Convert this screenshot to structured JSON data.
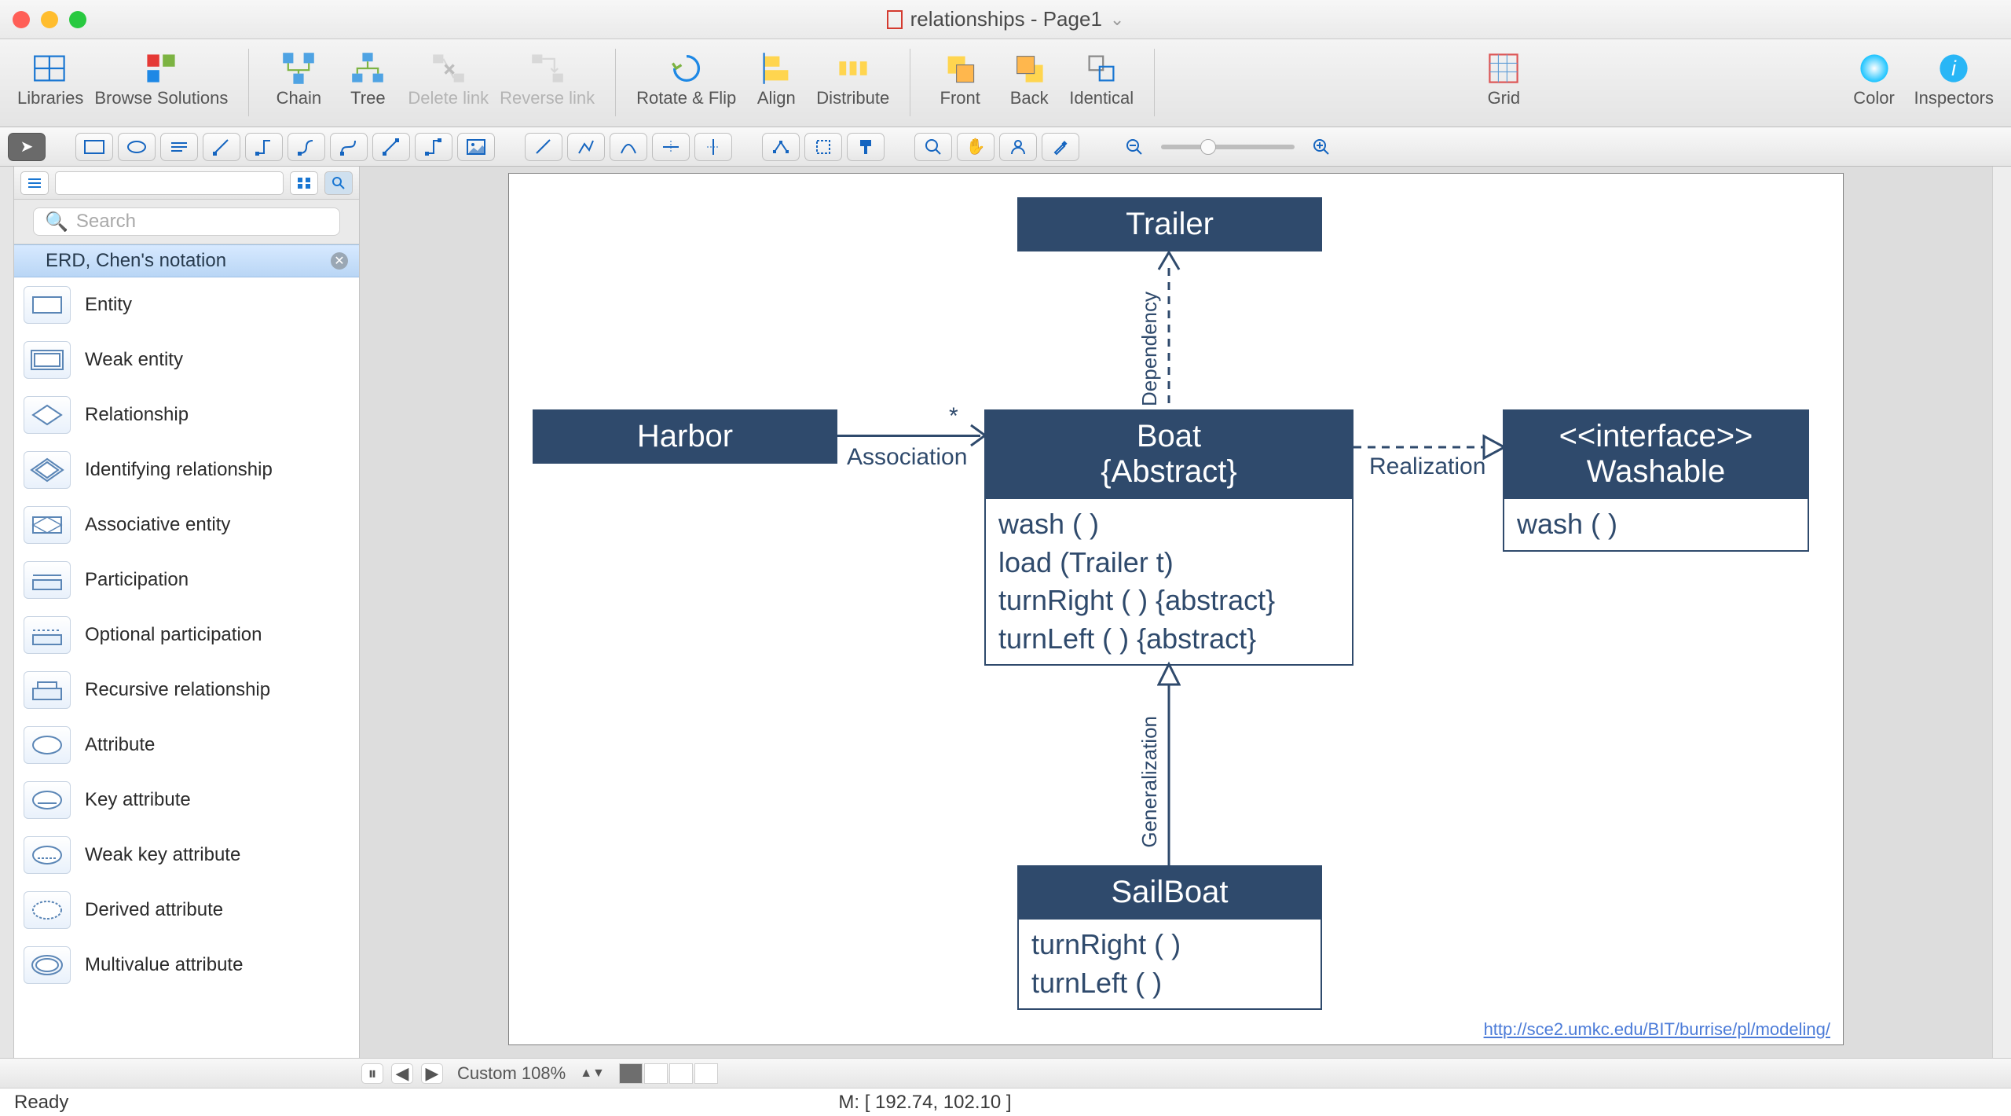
{
  "window": {
    "title": "relationships - Page1"
  },
  "toolbar": {
    "libraries": "Libraries",
    "browse": "Browse Solutions",
    "chain": "Chain",
    "tree": "Tree",
    "delete_link": "Delete link",
    "reverse_link": "Reverse link",
    "rotate_flip": "Rotate & Flip",
    "align": "Align",
    "distribute": "Distribute",
    "front": "Front",
    "back": "Back",
    "identical": "Identical",
    "grid": "Grid",
    "color": "Color",
    "inspectors": "Inspectors"
  },
  "search": {
    "placeholder": "Search"
  },
  "category": {
    "title": "ERD, Chen's notation"
  },
  "shapes": [
    "Entity",
    "Weak entity",
    "Relationship",
    "Identifying relationship",
    "Associative entity",
    "Participation",
    "Optional participation",
    "Recursive relationship",
    "Attribute",
    "Key attribute",
    "Weak key attribute",
    "Derived attribute",
    "Multivalue attribute"
  ],
  "diagram": {
    "trailer": "Trailer",
    "harbor": "Harbor",
    "boat_title": "Boat",
    "boat_sub": "{Abstract}",
    "boat_ops": [
      "wash ( )",
      "load (Trailer t)",
      "turnRight ( ) {abstract}",
      "turnLeft ( ) {abstract}"
    ],
    "interface_stereo": "<<interface>>",
    "interface_name": "Washable",
    "interface_ops": [
      "wash ( )"
    ],
    "sailboat": "SailBoat",
    "sailboat_ops": [
      "turnRight ( )",
      "turnLeft ( )"
    ],
    "lbl_association": "Association",
    "lbl_star": "*",
    "lbl_dependency": "Dependency",
    "lbl_realization": "Realization",
    "lbl_generalization": "Generalization",
    "footer_url": "http://sce2.umkc.edu/BIT/burrise/pl/modeling/"
  },
  "tabbar": {
    "zoom": "Custom 108%"
  },
  "status": {
    "ready": "Ready",
    "mouse": "M: [ 192.74, 102.10 ]"
  }
}
